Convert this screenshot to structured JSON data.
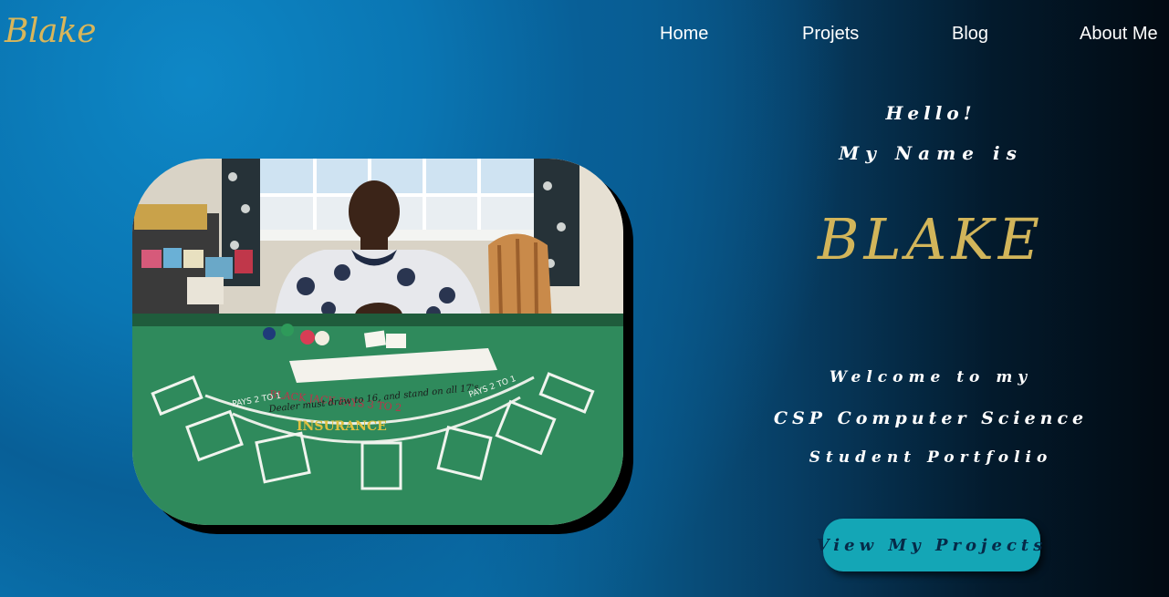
{
  "header": {
    "logo": "Blake",
    "nav": [
      {
        "label": "Home"
      },
      {
        "label": "Projets"
      },
      {
        "label": "Blog"
      },
      {
        "label": "About Me"
      }
    ]
  },
  "hero": {
    "greeting": "Hello!",
    "intro": "My Name is",
    "name": "BLAKE",
    "welcome": "Welcome to my",
    "program": "CSP Computer Science",
    "portfolio": "Student Portfolio",
    "cta_label": "View My Projects"
  },
  "photo": {
    "table_text_line1": "BLACK JACK PAYS 3 TO 2",
    "table_text_line2": "Dealer must draw to 16, and stand on all 17's",
    "table_text_insurance": "INSURANCE",
    "table_text_pays_left": "PAYS 2 TO 1",
    "table_text_pays_right": "PAYS 2 TO 1"
  },
  "colors": {
    "logo_gold": "#d9b65a",
    "name_gold": "#d2b55a",
    "cta_teal": "#14a6b6",
    "cta_text": "#062a48",
    "felt_green": "#2f8a5c"
  }
}
